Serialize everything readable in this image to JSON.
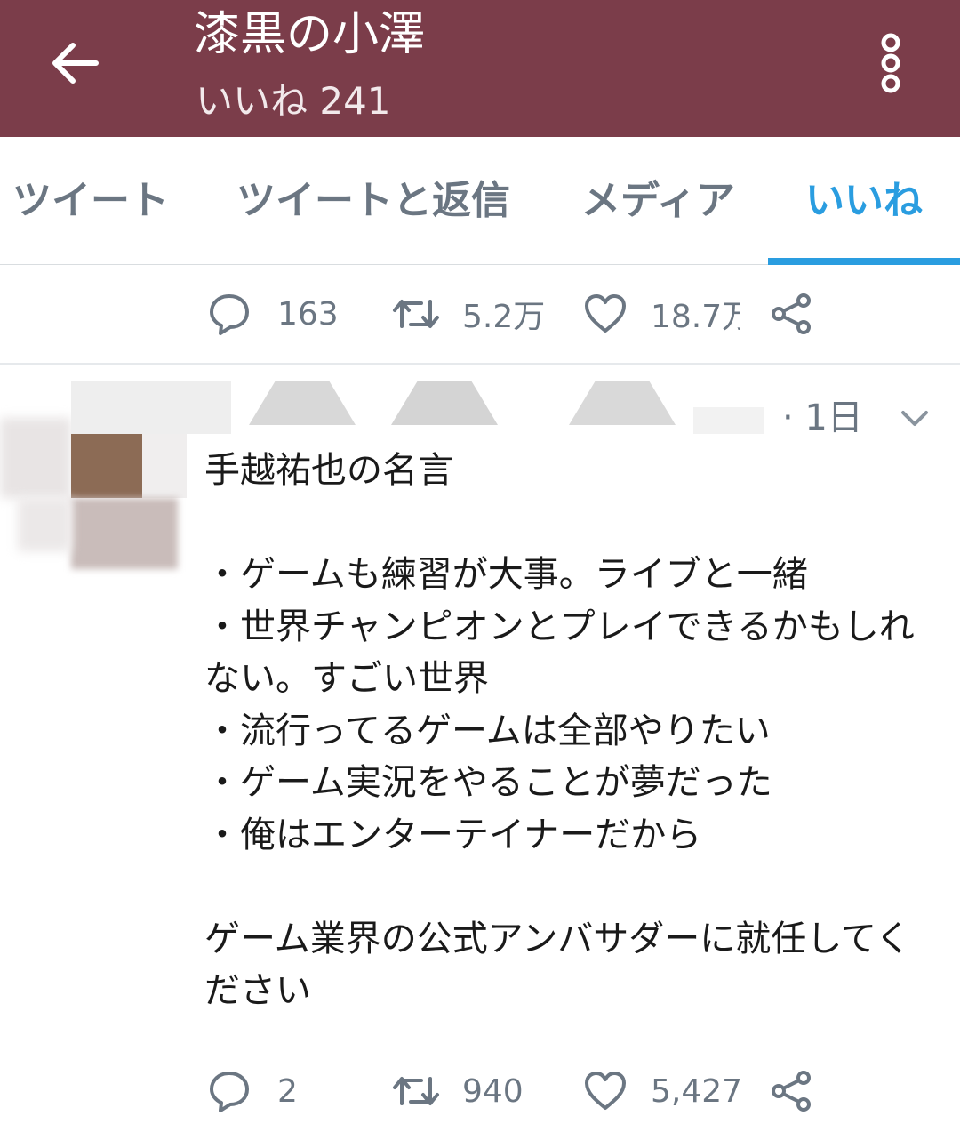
{
  "header": {
    "title": "漆黒の小澤",
    "subtitle": "いいね 241",
    "bg_color": "#7b3d4a"
  },
  "tabs": [
    {
      "label": "ツイート",
      "active": false
    },
    {
      "label": "ツイートと返信",
      "active": false
    },
    {
      "label": "メディア",
      "active": false
    },
    {
      "label": "いいね",
      "active": true
    }
  ],
  "accent_color": "#2a9de0",
  "prev_tweet_actions": {
    "reply_count": "163",
    "retweet_count": "5.2万",
    "like_count": "18.7万"
  },
  "tweet": {
    "time": "· 1日",
    "text": "手越祐也の名言\n\n・ゲームも練習が大事。ライブと一緒\n・世界チャンピオンとプレイできるかもしれない。すごい世界\n・流行ってるゲームは全部やりたい\n・ゲーム実況をやることが夢だった\n・俺はエンターテイナーだから\n\nゲーム業界の公式アンバサダーに就任してください",
    "actions": {
      "reply_count": "2",
      "retweet_count": "940",
      "like_count": "5,427"
    }
  }
}
